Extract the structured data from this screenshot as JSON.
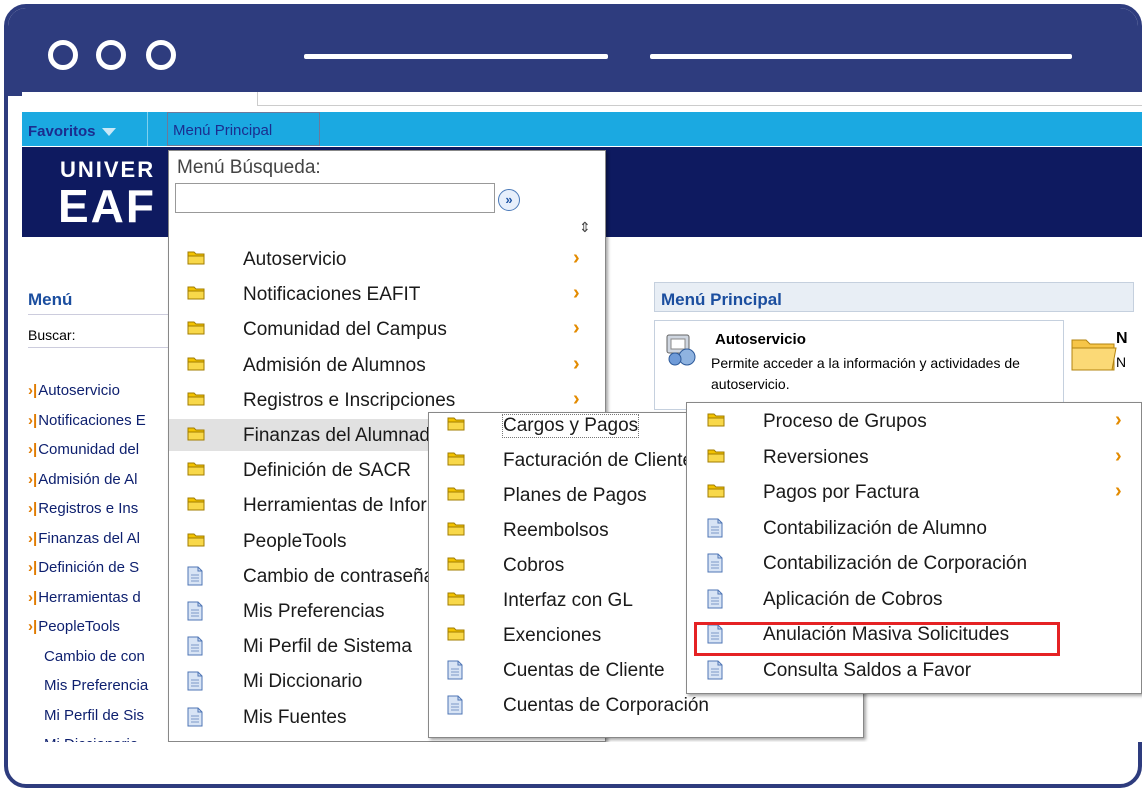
{
  "nav": {
    "favoritos": "Favoritos",
    "menu_principal": "Menú Principal"
  },
  "banner": {
    "line1": "UNIVER",
    "line2": "EAF"
  },
  "left_panel": {
    "title": "Menú",
    "buscar": "Buscar:",
    "items": [
      {
        "label": "Autoservicio",
        "arrow": true
      },
      {
        "label": "Notificaciones E",
        "arrow": true
      },
      {
        "label": "Comunidad del",
        "arrow": true
      },
      {
        "label": "Admisión de Al",
        "arrow": true
      },
      {
        "label": "Registros e Ins",
        "arrow": true
      },
      {
        "label": "Finanzas del Al",
        "arrow": true
      },
      {
        "label": "Definición de S",
        "arrow": true
      },
      {
        "label": "Herramientas d",
        "arrow": true
      },
      {
        "label": "PeopleTools",
        "arrow": true
      },
      {
        "label": "Cambio de con",
        "arrow": false
      },
      {
        "label": "Mis Preferencia",
        "arrow": false
      },
      {
        "label": "Mi Perfil de Sis",
        "arrow": false
      },
      {
        "label": "Mi Diccionario",
        "arrow": false
      }
    ]
  },
  "right_panel": {
    "title": "Menú Principal",
    "autoservicio_title": "Autoservicio",
    "autoservicio_desc": "Permite acceder a la información y actividades de autoservicio.",
    "right_title": "N",
    "right_desc": "N"
  },
  "menu1": {
    "search_label": "Menú Búsqueda:",
    "search_value": "",
    "items": [
      {
        "label": "Autoservicio",
        "icon": "folder-icon",
        "arrow": true
      },
      {
        "label": "Notificaciones EAFIT",
        "icon": "folder-icon",
        "arrow": true
      },
      {
        "label": "Comunidad del Campus",
        "icon": "folder-icon",
        "arrow": true
      },
      {
        "label": "Admisión de Alumnos",
        "icon": "folder-icon",
        "arrow": true
      },
      {
        "label": "Registros e Inscripciones",
        "icon": "folder-icon",
        "arrow": true
      },
      {
        "label": "Finanzas del Alumnado",
        "icon": "folder-icon",
        "arrow": false
      },
      {
        "label": "Definición de SACR",
        "icon": "folder-icon",
        "arrow": false
      },
      {
        "label": "Herramientas de Informes",
        "icon": "folder-icon",
        "arrow": false
      },
      {
        "label": "PeopleTools",
        "icon": "folder-icon",
        "arrow": false
      },
      {
        "label": "Cambio de contraseña",
        "icon": "page-icon",
        "arrow": false
      },
      {
        "label": "Mis Preferencias",
        "icon": "page-icon",
        "arrow": false
      },
      {
        "label": "Mi Perfil de Sistema",
        "icon": "page-icon",
        "arrow": false
      },
      {
        "label": "Mi Diccionario",
        "icon": "page-icon",
        "arrow": false
      },
      {
        "label": "Mis Fuentes",
        "icon": "page-icon",
        "arrow": false
      }
    ]
  },
  "menu2": {
    "items": [
      {
        "label": "Cargos y Pagos",
        "icon": "folder-icon"
      },
      {
        "label": "Facturación de Clientes",
        "icon": "folder-icon"
      },
      {
        "label": "Planes de Pagos",
        "icon": "folder-icon"
      },
      {
        "label": "Reembolsos",
        "icon": "folder-icon"
      },
      {
        "label": "Cobros",
        "icon": "folder-icon"
      },
      {
        "label": "Interfaz con GL",
        "icon": "folder-icon"
      },
      {
        "label": "Exenciones",
        "icon": "folder-icon"
      },
      {
        "label": "Cuentas de Cliente",
        "icon": "page-icon"
      },
      {
        "label": "Cuentas de Corporación",
        "icon": "page-icon"
      }
    ]
  },
  "menu3": {
    "items": [
      {
        "label": "Proceso de Grupos",
        "icon": "folder-icon",
        "arrow": true
      },
      {
        "label": "Reversiones",
        "icon": "folder-icon",
        "arrow": true
      },
      {
        "label": "Pagos por Factura",
        "icon": "folder-icon",
        "arrow": true
      },
      {
        "label": "Contabilización de Alumno",
        "icon": "page-icon",
        "arrow": false
      },
      {
        "label": "Contabilización de Corporación",
        "icon": "page-icon",
        "arrow": false
      },
      {
        "label": "Aplicación de Cobros",
        "icon": "page-icon",
        "arrow": false
      },
      {
        "label": "Anulación Masiva Solicitudes",
        "icon": "page-icon",
        "arrow": false
      },
      {
        "label": "Consulta Saldos a Favor",
        "icon": "page-icon",
        "arrow": false
      }
    ]
  },
  "colors": {
    "frame": "#2e3c7e",
    "navbar": "#1ba9e1",
    "banner": "#0e1a60",
    "highlight_box": "#e52224",
    "folder": "#f3c200",
    "arrow": "#e38b00"
  }
}
